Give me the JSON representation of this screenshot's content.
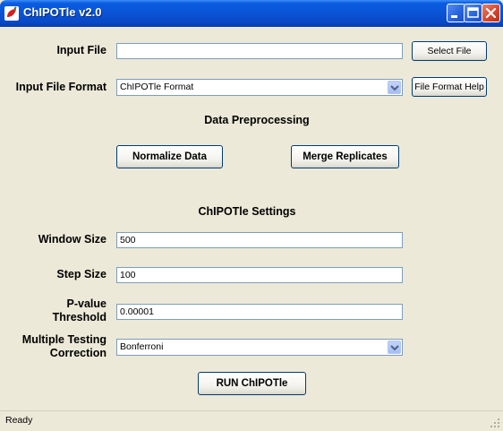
{
  "window": {
    "title": "ChIPOTle v2.0"
  },
  "input_file": {
    "label": "Input File",
    "value": "",
    "select_button": "Select File"
  },
  "input_format": {
    "label": "Input File Format",
    "selected": "ChIPOTle Format",
    "help_button": "File Format Help"
  },
  "preprocessing": {
    "heading": "Data Preprocessing",
    "normalize_button": "Normalize Data",
    "merge_button": "Merge Replicates"
  },
  "settings": {
    "heading": "ChIPOTle Settings",
    "window_size": {
      "label": "Window Size",
      "value": "500"
    },
    "step_size": {
      "label": "Step Size",
      "value": "100"
    },
    "pvalue": {
      "label_line1": "P-value",
      "label_line2": "Threshold",
      "value": "0.00001"
    },
    "multiple_testing": {
      "label_line1": "Multiple Testing",
      "label_line2": "Correction",
      "selected": "Bonferroni"
    }
  },
  "run_button": "RUN ChIPOTle",
  "status": {
    "text": "Ready"
  },
  "icons": {
    "app": "chipotle-app-icon",
    "minimize": "minimize-icon",
    "maximize": "maximize-icon",
    "close": "close-icon",
    "dropdown": "chevron-down-icon",
    "grip": "resize-grip-icon"
  },
  "colors": {
    "titlebar": "#0a53d6",
    "window_bg": "#ece9d8",
    "field_border": "#7f9db9",
    "button_border": "#003c74",
    "close_button": "#d2452b"
  }
}
